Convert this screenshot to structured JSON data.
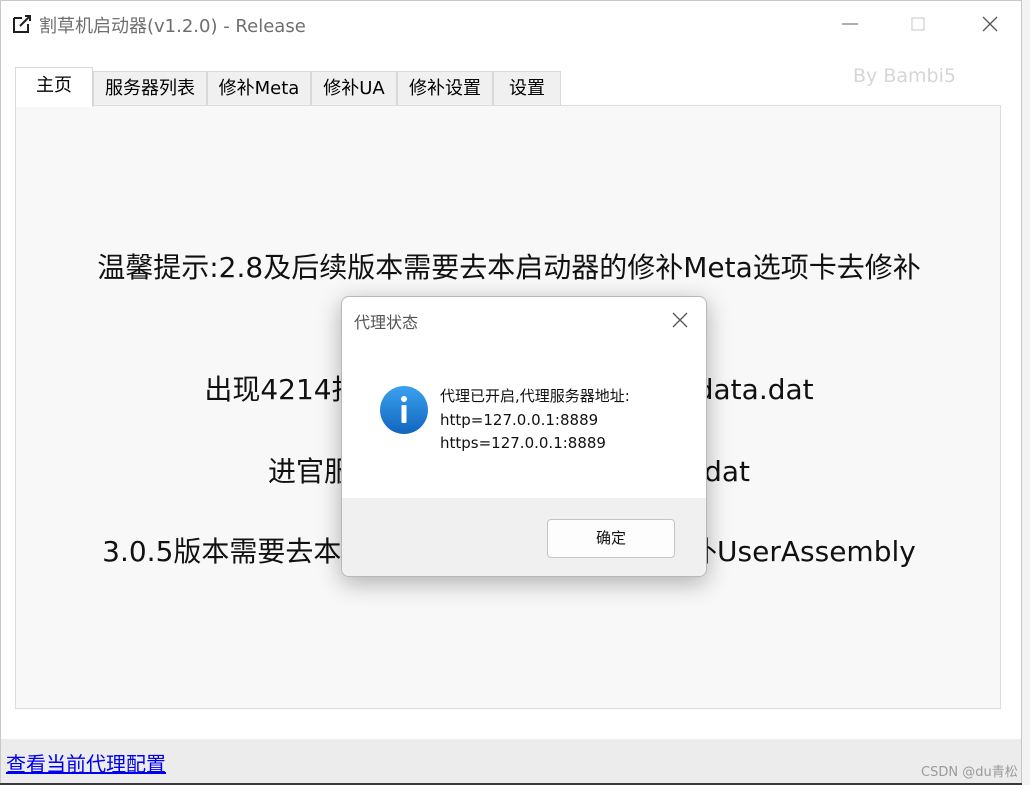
{
  "window": {
    "title": "割草机启动器(v1.2.0) - Release",
    "byline": "By Bambi5"
  },
  "tabs": [
    {
      "label": "主页",
      "active": true
    },
    {
      "label": "服务器列表",
      "active": false
    },
    {
      "label": "修补Meta",
      "active": false
    },
    {
      "label": "修补UA",
      "active": false
    },
    {
      "label": "修补设置",
      "active": false
    },
    {
      "label": "设置",
      "active": false
    }
  ],
  "main": {
    "tips": [
      "温馨提示:2.8及后续版本需要去本启动器的修补Meta选项卡去修补",
      "出现4214报错需要去修补global-metadata.dat",
      "进官服需要还原global-metadata.dat",
      "3.0.5版本需要去本启动器的修补UA选项卡去修补UserAssembly"
    ]
  },
  "statusbar": {
    "link": "查看当前代理配置",
    "watermark": "CSDN @du青松"
  },
  "dialog": {
    "title": "代理状态",
    "message_lines": [
      "代理已开启,代理服务器地址:",
      "http=127.0.0.1:8889",
      "https=127.0.0.1:8889"
    ],
    "ok_label": "确定",
    "icon": "info-icon"
  },
  "colors": {
    "info_icon": "#1a7fd4",
    "link": "#0000ee",
    "panel_bg": "#f8f8f8"
  }
}
